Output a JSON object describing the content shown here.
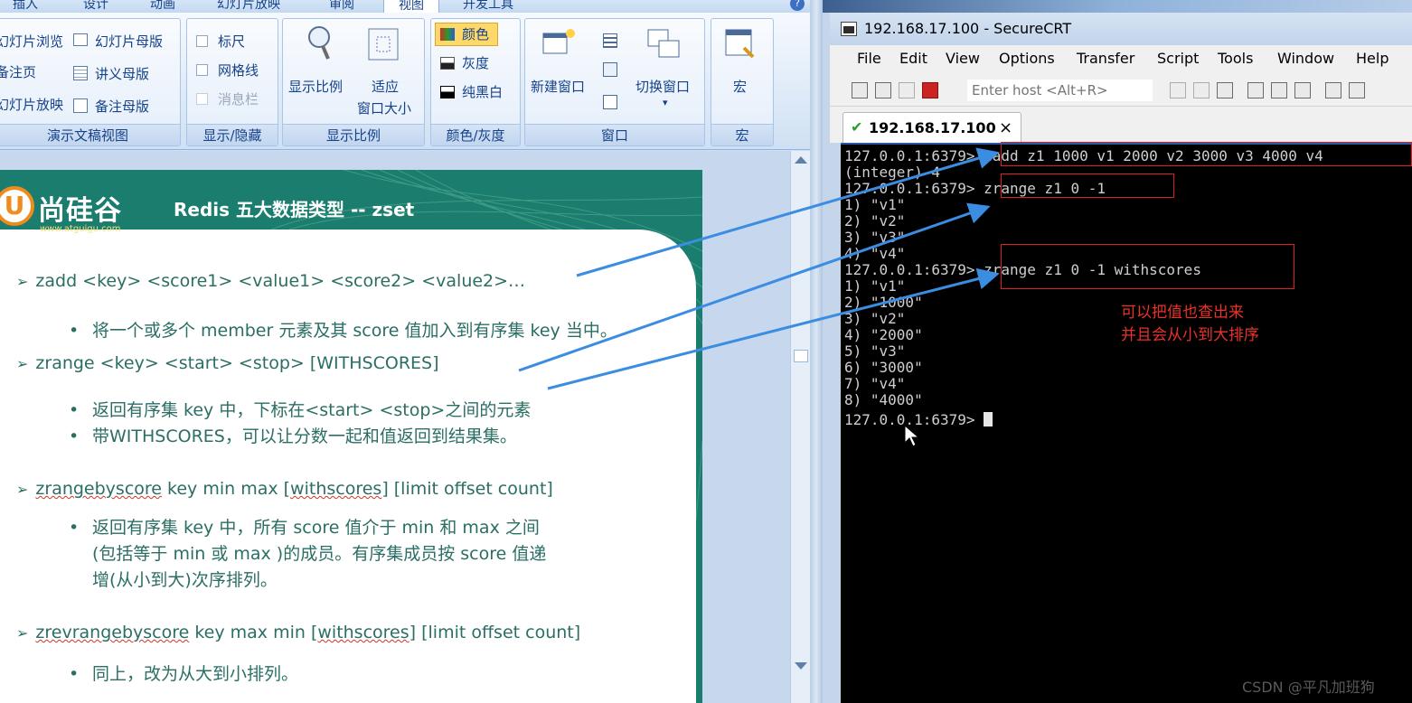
{
  "ppt": {
    "tabs": [
      "插入",
      "设计",
      "动画",
      "幻灯片放映",
      "审阅",
      "视图",
      "开发工具"
    ],
    "active_tab": "视图",
    "groups": {
      "views": {
        "label": "演示文稿视图",
        "items": [
          "幻灯片浏览",
          "备注页",
          "幻灯片放映",
          "幻灯片母版",
          "讲义母版",
          "备注母版"
        ]
      },
      "showhide": {
        "label": "显示/隐藏",
        "items": [
          "标尺",
          "网格线",
          "消息栏"
        ]
      },
      "zoom": {
        "label": "显示比例",
        "zoom_label": "显示比例",
        "fit_label_1": "适应",
        "fit_label_2": "窗口大小"
      },
      "color": {
        "label": "颜色/灰度",
        "items": [
          "颜色",
          "灰度",
          "纯黑白"
        ]
      },
      "window": {
        "label": "窗口",
        "new_window": "新建窗口",
        "switch_window": "切换窗口"
      },
      "macro": {
        "label": "宏",
        "macro_btn": "宏"
      }
    },
    "slide": {
      "logo_text": "尚硅谷",
      "logo_url": "www.atguigu.com",
      "title": "Redis 五大数据类型 -- zset",
      "lines": {
        "l1": "zadd  <key> <score1> <value1>  <score2> <value2>…",
        "l1_sub": "将一个或多个 member 元素及其 score 值加入到有序集 key 当中。",
        "l2": "zrange <key>  <start> <stop>  [WITHSCORES]",
        "l2_sub1": "返回有序集 key 中，下标在<start> <stop>之间的元素",
        "l2_sub2": "带WITHSCORES，可以让分数一起和值返回到结果集。",
        "l3_cmd": "zrangebyscore",
        "l3_rest": " key min max [",
        "l3_ws": "withscores",
        "l3_tail": "] [limit offset count]",
        "l3_sub1": "返回有序集 key 中，所有 score 值介于 min 和 max 之间",
        "l3_sub2": "(包括等于 min 或 max )的成员。有序集成员按 score 值递",
        "l3_sub3": "增(从小到大)次序排列。",
        "l4_cmd": "zrevrangebyscore",
        "l4_rest": " key max min [",
        "l4_ws": "withscores",
        "l4_tail": "] [limit offset count]",
        "l4_sub": "同上，改为从大到小排列。"
      }
    }
  },
  "crt": {
    "title": "192.168.17.100 - SecureCRT",
    "menu": [
      "File",
      "Edit",
      "View",
      "Options",
      "Transfer",
      "Script",
      "Tools",
      "Window",
      "Help"
    ],
    "host_placeholder": "Enter host <Alt+R>",
    "session_tab": "192.168.17.100",
    "terminal_lines": [
      "127.0.0.1:6379> zadd z1 1000 v1 2000 v2 3000 v3 4000 v4",
      "(integer) 4",
      "127.0.0.1:6379> zrange z1 0 -1",
      "1) \"v1\"",
      "2) \"v2\"",
      "3) \"v3\"",
      "4) \"v4\"",
      "127.0.0.1:6379> zrange z1 0 -1 withscores",
      "1) \"v1\"",
      "2) \"1000\"",
      "3) \"v2\"",
      "4) \"2000\"",
      "5) \"v3\"",
      "6) \"3000\"",
      "7) \"v4\"",
      "8) \"4000\"",
      "127.0.0.1:6379> "
    ],
    "note_line1": "可以把值也查出来",
    "note_line2": "并且会从小到大排序"
  },
  "watermark": "CSDN @平凡加班狗",
  "colors": {
    "slide_teal": "#1a7d6d",
    "slide_text": "#2a6e64",
    "annotation_red": "#e02020",
    "arrow_blue": "#3a8de0"
  }
}
